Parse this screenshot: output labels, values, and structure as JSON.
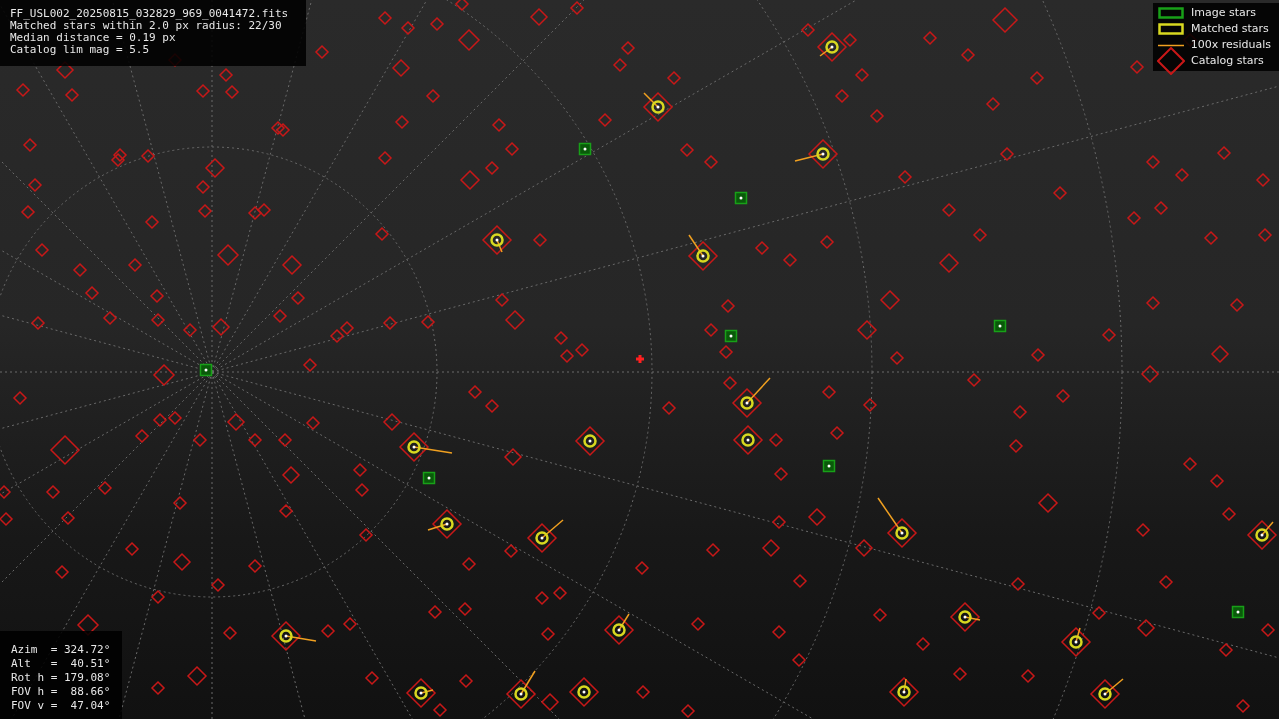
{
  "info_lines": [
    "FF_USL002_20250815_032829_969_0041472.fits",
    "Matched stars within 2.0 px radius: 22/30",
    "Median distance = 0.19 px",
    "Catalog lim mag = 5.5"
  ],
  "legend": [
    {
      "kind": "image",
      "label": "Image stars"
    },
    {
      "kind": "matched",
      "label": "Matched stars"
    },
    {
      "kind": "residual",
      "label": "100x residuals"
    },
    {
      "kind": "catalog",
      "label": "Catalog stars"
    }
  ],
  "pointing_lines": [
    "Azim  = 324.72°",
    "Alt   =  40.51°",
    "Rot h = 179.08°",
    "FOV h =  88.66°",
    "FOV v =  47.04°"
  ]
}
